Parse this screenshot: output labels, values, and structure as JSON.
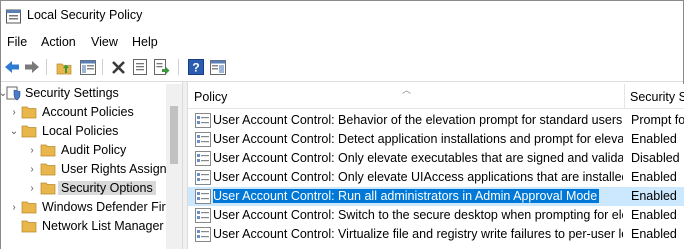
{
  "window": {
    "title": "Local Security Policy",
    "icon": "security-policy-icon"
  },
  "menu": [
    "File",
    "Action",
    "View",
    "Help"
  ],
  "toolbar": {
    "buttons": [
      "back-arrow-icon",
      "forward-arrow-icon",
      "up-folder-icon",
      "show-hide-tree-icon",
      "delete-icon",
      "properties-icon",
      "export-list-icon",
      "help-icon",
      "show-action-pane-icon"
    ]
  },
  "tree": {
    "items": [
      {
        "label": "Security Settings",
        "chevron": "⌄",
        "icon": "shield-icon"
      },
      {
        "label": "Account Policies",
        "chevron": "›",
        "icon": "folder-icon"
      },
      {
        "label": "Local Policies",
        "chevron": "⌄",
        "icon": "folder-icon"
      },
      {
        "label": "Audit Policy",
        "chevron": "›",
        "icon": "folder-icon"
      },
      {
        "label": "User Rights Assignm",
        "chevron": "›",
        "icon": "folder-icon"
      },
      {
        "label": "Security Options",
        "chevron": "›",
        "icon": "folder-icon"
      },
      {
        "label": "Windows Defender Fire",
        "chevron": "›",
        "icon": "folder-icon"
      },
      {
        "label": "Network List Manager P",
        "chevron": "",
        "icon": "folder-icon"
      }
    ]
  },
  "list": {
    "columns": {
      "policy": "Policy",
      "setting": "Security Se"
    },
    "rows": [
      {
        "policy": "User Account Control: Behavior of the elevation prompt for standard users",
        "setting": "Prompt fo"
      },
      {
        "policy": "User Account Control: Detect application installations and prompt for elevati...",
        "setting": "Enabled"
      },
      {
        "policy": "User Account Control: Only elevate executables that are signed and validated",
        "setting": "Disabled"
      },
      {
        "policy": "User Account Control: Only elevate UIAccess applications that are installed i...",
        "setting": "Enabled"
      },
      {
        "policy": "User Account Control: Run all administrators in Admin Approval Mode",
        "setting": "Enabled"
      },
      {
        "policy": "User Account Control: Switch to the secure desktop when prompting for ele...",
        "setting": "Enabled"
      },
      {
        "policy": "User Account Control: Virtualize file and registry write failures to per-user loc...",
        "setting": "Enabled"
      }
    ]
  },
  "colors": {
    "selection": "#0078d7",
    "selection_row": "#cce8ff",
    "folder": "#e8b64a"
  }
}
